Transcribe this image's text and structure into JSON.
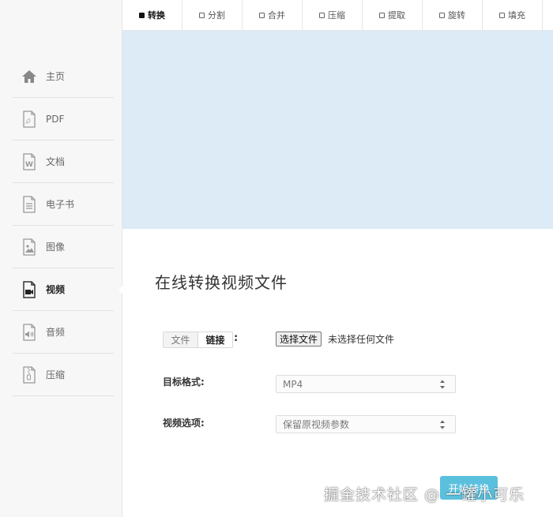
{
  "tabs": [
    {
      "label": "转换",
      "active": true
    },
    {
      "label": "分割",
      "active": false
    },
    {
      "label": "合并",
      "active": false
    },
    {
      "label": "压缩",
      "active": false
    },
    {
      "label": "提取",
      "active": false
    },
    {
      "label": "旋转",
      "active": false
    },
    {
      "label": "填充",
      "active": false
    }
  ],
  "sidebar": {
    "items": [
      {
        "label": "主页",
        "icon": "home-icon"
      },
      {
        "label": "PDF",
        "icon": "pdf-file-icon"
      },
      {
        "label": "文档",
        "icon": "word-document-icon"
      },
      {
        "label": "电子书",
        "icon": "ebook-icon"
      },
      {
        "label": "图像",
        "icon": "image-icon"
      },
      {
        "label": "视频",
        "icon": "video-icon",
        "active": true
      },
      {
        "label": "音频",
        "icon": "audio-icon"
      },
      {
        "label": "压缩",
        "icon": "archive-icon"
      }
    ]
  },
  "main": {
    "title": "在线转换视频文件",
    "source_toggle": {
      "file_label": "文件",
      "link_label": "链接",
      "selected": "链接",
      "colon": ":"
    },
    "file_input": {
      "button_label": "选择文件",
      "status": "未选择任何文件"
    },
    "target_format": {
      "label": "目标格式:",
      "value": "MP4"
    },
    "video_options": {
      "label": "视频选项:",
      "value": "保留原视频参数"
    },
    "start_button": {
      "label": "开始转换"
    }
  },
  "watermark": "掘金技术社区 @ 一罐小可乐",
  "colors": {
    "banner": "#dcebf5",
    "sidebar_bg": "#f7f7f7",
    "accent_button": "#5bc0de"
  }
}
